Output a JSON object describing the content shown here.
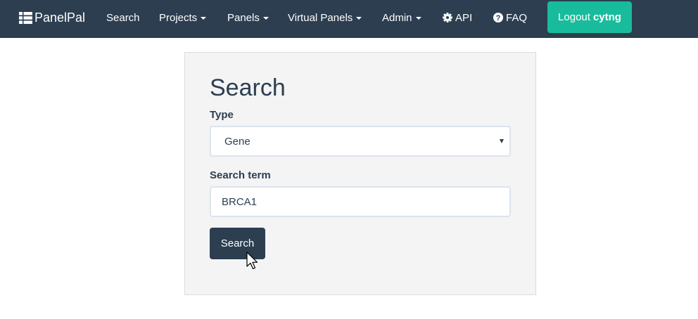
{
  "navbar": {
    "brand": "PanelPal",
    "brand_icon": "list-icon",
    "items": [
      {
        "label": "Search",
        "dropdown": false
      },
      {
        "label": "Projects",
        "dropdown": true
      },
      {
        "label": "Panels",
        "dropdown": true
      },
      {
        "label": "Virtual Panels",
        "dropdown": true
      },
      {
        "label": "Admin",
        "dropdown": true
      }
    ],
    "api_label": "API",
    "api_icon": "gear-icon",
    "faq_label": "FAQ",
    "faq_icon": "question-circle-icon",
    "logout_label": "Logout",
    "logout_user": "cytng"
  },
  "search_form": {
    "title": "Search",
    "type_label": "Type",
    "type_value": "Gene",
    "term_label": "Search term",
    "term_value": "BRCA1",
    "submit_label": "Search"
  },
  "colors": {
    "navbar_bg": "#2c3e50",
    "logout_bg": "#18bc9c",
    "panel_bg": "#f4f4f4",
    "button_bg": "#2c3e50"
  }
}
